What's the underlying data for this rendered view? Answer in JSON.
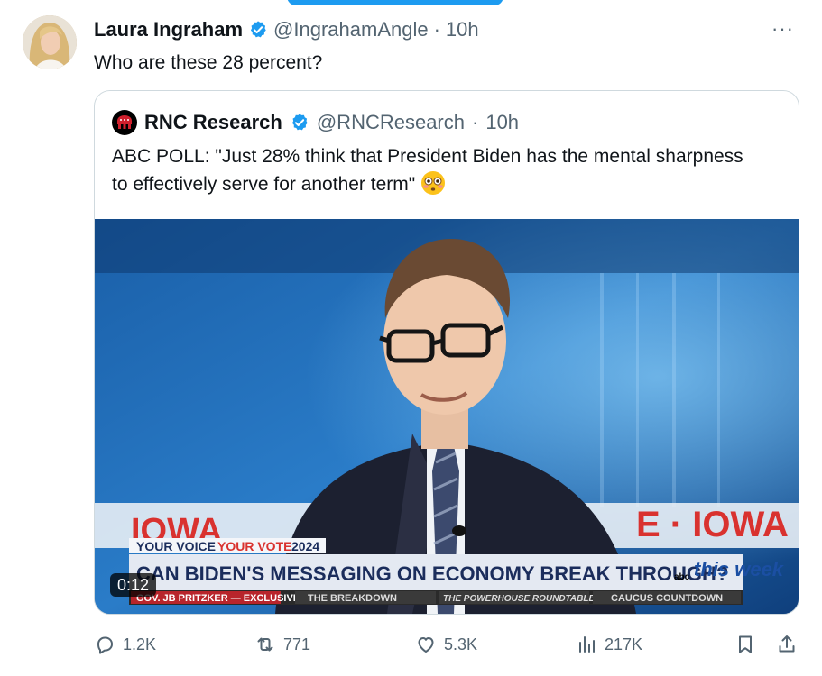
{
  "tweet": {
    "author_name": "Laura Ingraham",
    "author_handle": "@IngrahamAngle",
    "separator": "·",
    "time": "10h",
    "text": "Who are these 28 percent?",
    "more_label": "···"
  },
  "quote": {
    "author_name": "RNC Research",
    "author_handle": "@RNCResearch",
    "separator": "·",
    "time": "10h",
    "text": "ABC POLL: \"Just 28% think that President Biden has the mental sharpness to effectively serve for another term\"",
    "emoji": "flushed-face",
    "media": {
      "duration": "0:12",
      "bg_word_left": "IOWA",
      "bg_word_right": "E · IOWA",
      "lower_third_top_left": "YOUR VOICE",
      "lower_third_top_mid": "YOUR VOTE",
      "lower_third_top_year": "2024",
      "headline": "CAN BIDEN'S MESSAGING ON ECONOMY BREAK THROUGH?",
      "network_small": "abc",
      "show_logo": "this week",
      "ticker": [
        "GOV. JB PRITZKER — EXCLUSIVE",
        "THE BREAKDOWN",
        "THE POWERHOUSE ROUNDTABLE",
        "CAUCUS COUNTDOWN"
      ]
    }
  },
  "actions": {
    "replies": "1.2K",
    "reposts": "771",
    "likes": "5.3K",
    "views": "217K"
  },
  "colors": {
    "verified": "#1d9bf0",
    "muted": "#536471",
    "border": "#cfd9de"
  }
}
